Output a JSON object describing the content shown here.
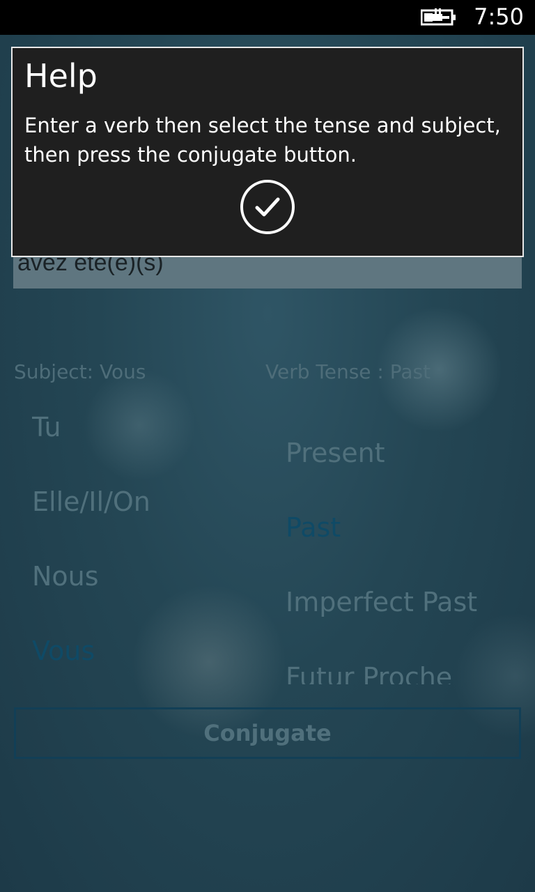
{
  "status_bar": {
    "time": "7:50",
    "battery_icon": "battery-charging-icon"
  },
  "dialog": {
    "title": "Help",
    "message": "Enter a verb then select the tense and subject, then press the conjugate button.",
    "ok_icon": "checkmark-circle-icon"
  },
  "verb_input": {
    "value": "avez été(e)(s)"
  },
  "subject": {
    "label": "Subject:  Vous",
    "items": [
      "Tu",
      "Elle/Il/On",
      "Nous",
      "Vous"
    ],
    "selected": "Vous"
  },
  "tense": {
    "label": "Verb Tense :  Past",
    "items": [
      "Present",
      "Past",
      "Imperfect Past",
      "Futur Proche"
    ],
    "selected": "Past"
  },
  "conjugate_button": {
    "label": "Conjugate"
  },
  "colors": {
    "dialog_background": "#1f1f1f",
    "dialog_border": "#e8e8e8",
    "accent_selected": "#0f4a66",
    "dim_text": "#50707c"
  }
}
